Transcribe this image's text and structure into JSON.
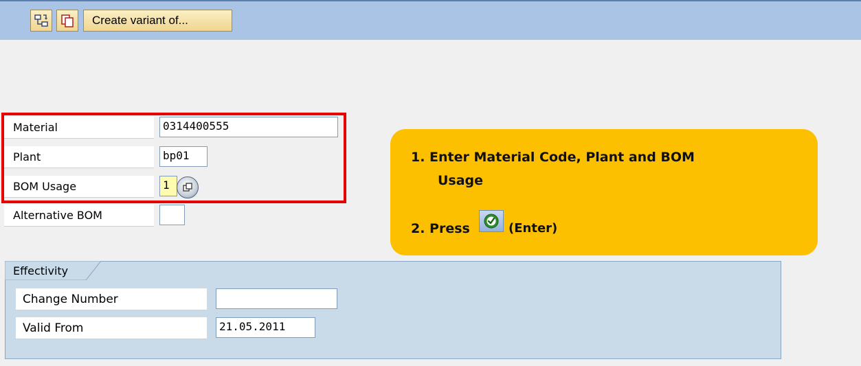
{
  "toolbar": {
    "buttons": [
      {
        "icon": "hierarchy-icon"
      },
      {
        "icon": "copy-icon"
      }
    ],
    "create_variant_label": "Create variant of..."
  },
  "form": {
    "material": {
      "label": "Material",
      "value": "0314400555"
    },
    "plant": {
      "label": "Plant",
      "value": "bp01"
    },
    "bom_usage": {
      "label": "BOM Usage",
      "value": "1"
    },
    "alternative_bom": {
      "label": "Alternative BOM",
      "value": ""
    }
  },
  "effectivity": {
    "title": "Effectivity",
    "change_number": {
      "label": "Change Number",
      "value": ""
    },
    "valid_from": {
      "label": "Valid From",
      "value": "21.05.2011"
    }
  },
  "callout": {
    "line1": "1. Enter Material Code, Plant and BOM",
    "line1b": "Usage",
    "line2_prefix": "2. Press",
    "line2_suffix": "(Enter)",
    "icon": "enter-check-icon"
  },
  "colors": {
    "toolbar_bg": "#a9c4e4",
    "callout_bg": "#fdc000",
    "highlight": "#e60000",
    "group_bg": "#c9dbe8"
  }
}
